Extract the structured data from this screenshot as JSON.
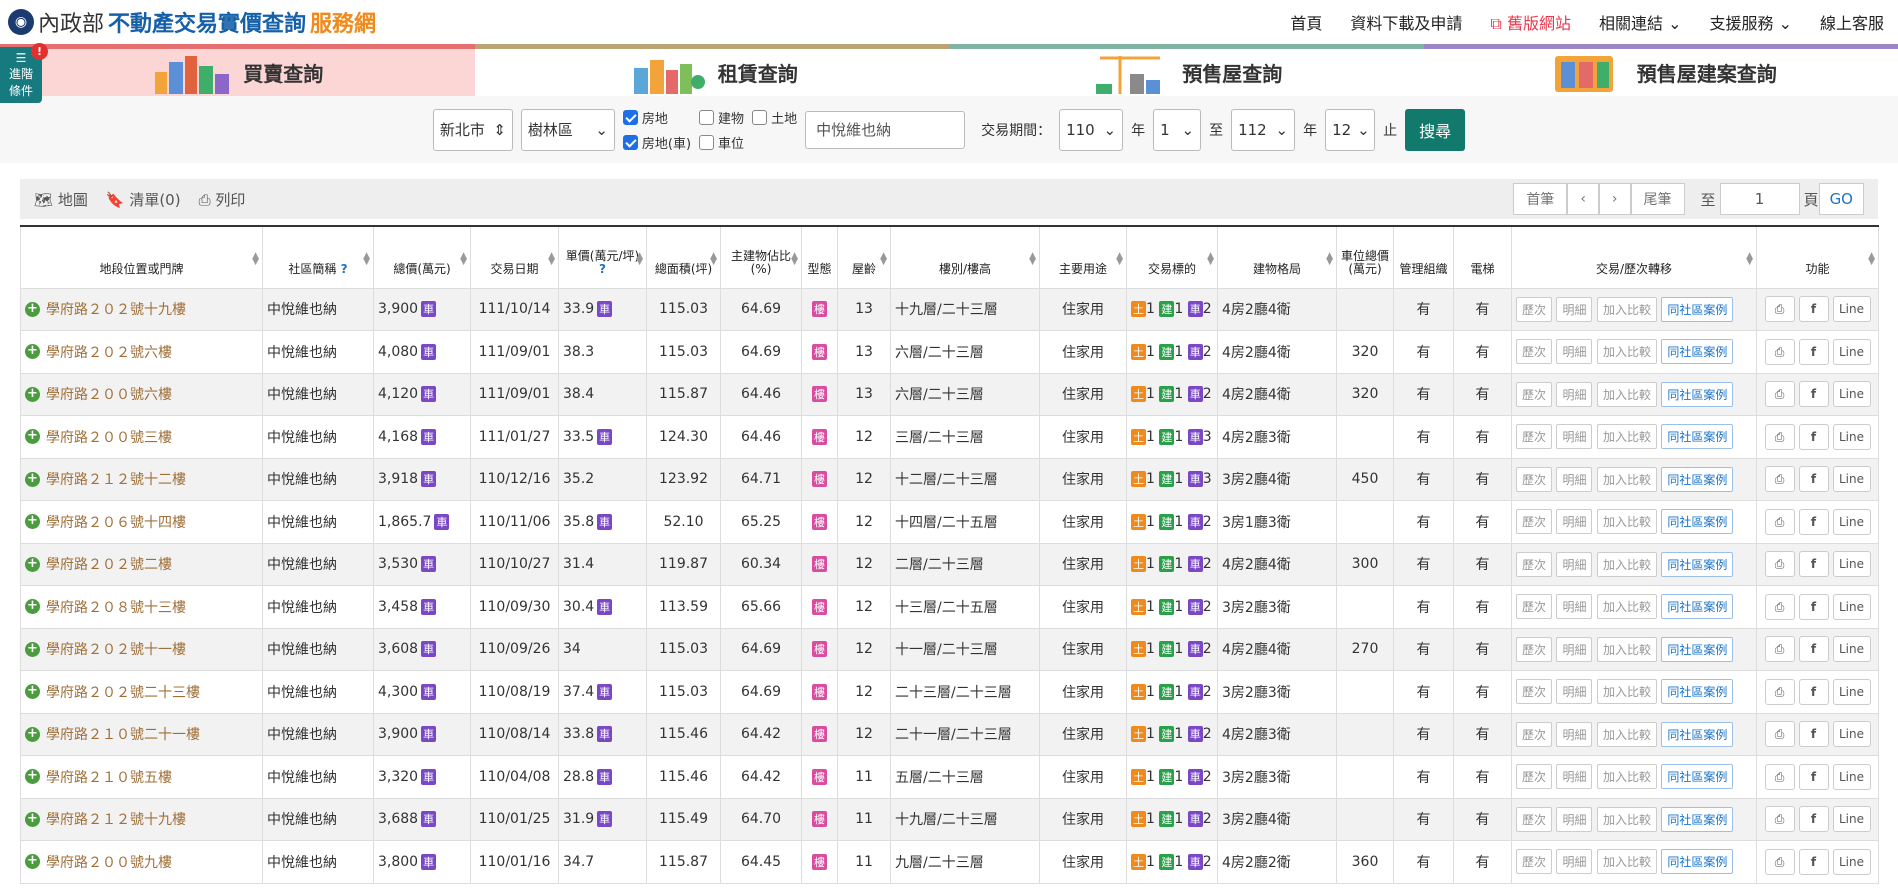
{
  "header": {
    "ministry": "內政部",
    "title": "不動產交易實價查詢",
    "service": "服務網",
    "nav": [
      "首頁",
      "資料下載及申請",
      "舊版網站",
      "相關連結",
      "支援服務",
      "線上客服"
    ]
  },
  "advanced": {
    "label1": "進階",
    "label2": "條件",
    "badge": "!"
  },
  "tabs": [
    "買賣查詢",
    "租賃查詢",
    "預售屋查詢",
    "預售屋建案查詢"
  ],
  "search": {
    "city": "新北市",
    "district": "樹林區",
    "opt_land_house": "房地",
    "opt_building": "建物",
    "opt_land": "土地",
    "opt_land_house_car": "房地(車)",
    "opt_parking": "車位",
    "keyword": "中悅維也納",
    "period_label": "交易期間：",
    "from_year": "110",
    "from_month": "1",
    "to_year": "112",
    "to_month": "12",
    "year_unit": "年",
    "to": "至",
    "end": "止",
    "submit": "搜尋"
  },
  "toolbar": {
    "map": "地圖",
    "list": "清單(0)",
    "print": "列印",
    "first": "首筆",
    "prev": "‹",
    "next": "›",
    "last": "尾筆",
    "goto": "至",
    "page": "1",
    "page_unit": "頁",
    "go": "GO"
  },
  "columns": [
    "地段位置或門牌",
    "社區簡稱",
    "總價(萬元)",
    "交易日期",
    "單價(萬元/坪)",
    "總面積(坪)",
    "主建物佔比(%)",
    "型態",
    "屋齡",
    "樓別/樓高",
    "主要用途",
    "交易標的",
    "建物格局",
    "車位總價(萬元)",
    "管理組織",
    "電梯",
    "交易/歷次轉移",
    "功能"
  ],
  "labels": {
    "car": "車",
    "lou": "樓",
    "land": "土",
    "bldg": "建",
    "park": "車",
    "history": "歷次",
    "detail": "明細",
    "compare": "加入比較",
    "same": "同社區案例",
    "fb": "f",
    "line": "Line",
    "print": "⎙"
  },
  "rows": [
    {
      "addr": "學府路２０２號十九樓",
      "community": "中悅維也納",
      "price": "3,900",
      "price_car": true,
      "date": "111/10/14",
      "unit": "33.9",
      "unit_car": true,
      "area": "115.03",
      "ratio": "64.69",
      "age": "13",
      "floor": "十九層/二十三層",
      "use": "住家用",
      "l": "1",
      "b": "1",
      "c": "2",
      "layout": "4房2廳4衛",
      "park": "",
      "mgmt": "有",
      "elev": "有"
    },
    {
      "addr": "學府路２０２號六樓",
      "community": "中悅維也納",
      "price": "4,080",
      "price_car": true,
      "date": "111/09/01",
      "unit": "38.3",
      "unit_car": false,
      "area": "115.03",
      "ratio": "64.69",
      "age": "13",
      "floor": "六層/二十三層",
      "use": "住家用",
      "l": "1",
      "b": "1",
      "c": "2",
      "layout": "4房2廳4衛",
      "park": "320",
      "mgmt": "有",
      "elev": "有"
    },
    {
      "addr": "學府路２００號六樓",
      "community": "中悅維也納",
      "price": "4,120",
      "price_car": true,
      "date": "111/09/01",
      "unit": "38.4",
      "unit_car": false,
      "area": "115.87",
      "ratio": "64.46",
      "age": "13",
      "floor": "六層/二十三層",
      "use": "住家用",
      "l": "1",
      "b": "1",
      "c": "2",
      "layout": "4房2廳4衛",
      "park": "320",
      "mgmt": "有",
      "elev": "有"
    },
    {
      "addr": "學府路２００號三樓",
      "community": "中悅維也納",
      "price": "4,168",
      "price_car": true,
      "date": "111/01/27",
      "unit": "33.5",
      "unit_car": true,
      "area": "124.30",
      "ratio": "64.46",
      "age": "12",
      "floor": "三層/二十三層",
      "use": "住家用",
      "l": "1",
      "b": "1",
      "c": "3",
      "layout": "4房2廳3衛",
      "park": "",
      "mgmt": "有",
      "elev": "有"
    },
    {
      "addr": "學府路２１２號十二樓",
      "community": "中悅維也納",
      "price": "3,918",
      "price_car": true,
      "date": "110/12/16",
      "unit": "35.2",
      "unit_car": false,
      "area": "123.92",
      "ratio": "64.71",
      "age": "12",
      "floor": "十二層/二十三層",
      "use": "住家用",
      "l": "1",
      "b": "1",
      "c": "3",
      "layout": "3房2廳4衛",
      "park": "450",
      "mgmt": "有",
      "elev": "有"
    },
    {
      "addr": "學府路２０６號十四樓",
      "community": "中悅維也納",
      "price": "1,865.7",
      "price_car": true,
      "date": "110/11/06",
      "unit": "35.8",
      "unit_car": true,
      "area": "52.10",
      "ratio": "65.25",
      "age": "12",
      "floor": "十四層/二十五層",
      "use": "住家用",
      "l": "1",
      "b": "1",
      "c": "2",
      "layout": "3房1廳3衛",
      "park": "",
      "mgmt": "有",
      "elev": "有"
    },
    {
      "addr": "學府路２０２號二樓",
      "community": "中悅維也納",
      "price": "3,530",
      "price_car": true,
      "date": "110/10/27",
      "unit": "31.4",
      "unit_car": false,
      "area": "119.87",
      "ratio": "60.34",
      "age": "12",
      "floor": "二層/二十三層",
      "use": "住家用",
      "l": "1",
      "b": "1",
      "c": "2",
      "layout": "4房2廳4衛",
      "park": "300",
      "mgmt": "有",
      "elev": "有"
    },
    {
      "addr": "學府路２０８號十三樓",
      "community": "中悅維也納",
      "price": "3,458",
      "price_car": true,
      "date": "110/09/30",
      "unit": "30.4",
      "unit_car": true,
      "area": "113.59",
      "ratio": "65.66",
      "age": "12",
      "floor": "十三層/二十五層",
      "use": "住家用",
      "l": "1",
      "b": "1",
      "c": "2",
      "layout": "3房2廳3衛",
      "park": "",
      "mgmt": "有",
      "elev": "有"
    },
    {
      "addr": "學府路２０２號十一樓",
      "community": "中悅維也納",
      "price": "3,608",
      "price_car": true,
      "date": "110/09/26",
      "unit": "34",
      "unit_car": false,
      "area": "115.03",
      "ratio": "64.69",
      "age": "12",
      "floor": "十一層/二十三層",
      "use": "住家用",
      "l": "1",
      "b": "1",
      "c": "2",
      "layout": "4房2廳4衛",
      "park": "270",
      "mgmt": "有",
      "elev": "有"
    },
    {
      "addr": "學府路２０２號二十三樓",
      "community": "中悅維也納",
      "price": "4,300",
      "price_car": true,
      "date": "110/08/19",
      "unit": "37.4",
      "unit_car": true,
      "area": "115.03",
      "ratio": "64.69",
      "age": "12",
      "floor": "二十三層/二十三層",
      "use": "住家用",
      "l": "1",
      "b": "1",
      "c": "2",
      "layout": "3房2廳3衛",
      "park": "",
      "mgmt": "有",
      "elev": "有"
    },
    {
      "addr": "學府路２１０號二十一樓",
      "community": "中悅維也納",
      "price": "3,900",
      "price_car": true,
      "date": "110/08/14",
      "unit": "33.8",
      "unit_car": true,
      "area": "115.46",
      "ratio": "64.42",
      "age": "12",
      "floor": "二十一層/二十三層",
      "use": "住家用",
      "l": "1",
      "b": "1",
      "c": "2",
      "layout": "4房2廳3衛",
      "park": "",
      "mgmt": "有",
      "elev": "有"
    },
    {
      "addr": "學府路２１０號五樓",
      "community": "中悅維也納",
      "price": "3,320",
      "price_car": true,
      "date": "110/04/08",
      "unit": "28.8",
      "unit_car": true,
      "area": "115.46",
      "ratio": "64.42",
      "age": "11",
      "floor": "五層/二十三層",
      "use": "住家用",
      "l": "1",
      "b": "1",
      "c": "2",
      "layout": "3房2廳3衛",
      "park": "",
      "mgmt": "有",
      "elev": "有"
    },
    {
      "addr": "學府路２１２號十九樓",
      "community": "中悅維也納",
      "price": "3,688",
      "price_car": true,
      "date": "110/01/25",
      "unit": "31.9",
      "unit_car": true,
      "area": "115.49",
      "ratio": "64.70",
      "age": "11",
      "floor": "十九層/二十三層",
      "use": "住家用",
      "l": "1",
      "b": "1",
      "c": "2",
      "layout": "3房2廳4衛",
      "park": "",
      "mgmt": "有",
      "elev": "有"
    },
    {
      "addr": "學府路２００號九樓",
      "community": "中悅維也納",
      "price": "3,800",
      "price_car": true,
      "date": "110/01/16",
      "unit": "34.7",
      "unit_car": false,
      "area": "115.87",
      "ratio": "64.45",
      "age": "11",
      "floor": "九層/二十三層",
      "use": "住家用",
      "l": "1",
      "b": "1",
      "c": "2",
      "layout": "4房2廳2衛",
      "park": "360",
      "mgmt": "有",
      "elev": "有"
    }
  ]
}
